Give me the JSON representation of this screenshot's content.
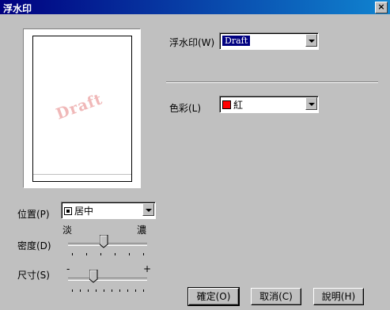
{
  "window": {
    "title": "浮水印",
    "close_glyph": "×"
  },
  "preview": {
    "watermark_text": "Draft",
    "watermark_color": "#f0b8b8"
  },
  "watermark": {
    "label": "浮水印(W)",
    "value": "Draft"
  },
  "color": {
    "label": "色彩(L)",
    "value": "紅",
    "swatch": "#ff0000"
  },
  "position": {
    "label": "位置(P)",
    "value": "居中"
  },
  "density": {
    "label": "密度(D)",
    "min_label": "淡",
    "max_label": "濃",
    "value_fraction": 0.45
  },
  "size": {
    "label": "尺寸(S)",
    "min_label": "-",
    "max_label": "+",
    "value_fraction": 0.3
  },
  "buttons": {
    "ok": "確定(O)",
    "cancel": "取消(C)",
    "help": "說明(H)"
  }
}
